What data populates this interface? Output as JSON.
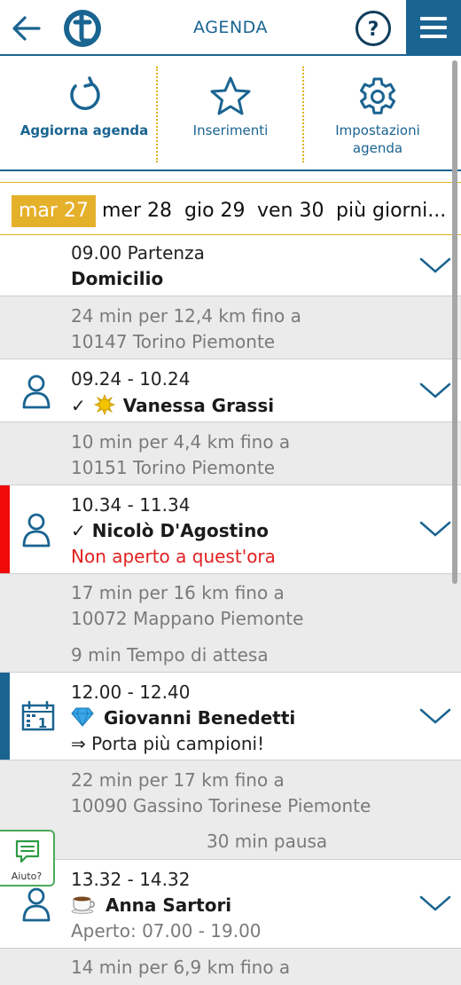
{
  "header": {
    "title": "AGENDA",
    "colors": {
      "brand": "#1a6491",
      "accent": "#e5b02a",
      "alert": "#e12121"
    }
  },
  "toolbar": {
    "refresh_label": "Aggiorna agenda",
    "insert_label": "Inserimenti",
    "settings_line1": "Impostazioni",
    "settings_line2": "agenda"
  },
  "dates": {
    "selected": "mar 27",
    "items": [
      "mer 28",
      "gio 29",
      "ven 30",
      "più giorni..."
    ]
  },
  "agenda": {
    "start": {
      "time": "09.00 Partenza",
      "place": "Domicilio"
    },
    "travel1": {
      "line1": "24 min per 12,4 km fino a",
      "line2": "10147 Torino Piemonte"
    },
    "appt1": {
      "time": "09.24 - 10.24",
      "check": "✓",
      "name": "Vanessa Grassi"
    },
    "travel2": {
      "line1": "10 min per 4,4 km fino a",
      "line2": "10151 Torino Piemonte"
    },
    "appt2": {
      "time": "10.34 - 11.34",
      "check": "✓",
      "name": "Nicolò D'Agostino",
      "note": "Non aperto a quest'ora"
    },
    "travel3": {
      "line1": "17 min per 16 km fino a",
      "line2": "10072 Mappano Piemonte",
      "wait": "9 min Tempo di attesa"
    },
    "appt3": {
      "time": "12.00 - 12.40",
      "name": "Giovanni Benedetti",
      "note": "⇒ Porta più campioni!"
    },
    "travel4": {
      "line1": "22 min per 17 km fino a",
      "line2": "10090 Gassino Torinese Piemonte",
      "pause": "30 min pausa"
    },
    "appt4": {
      "time": "13.32 - 14.32",
      "name": "Anna Sartori",
      "hours": "Aperto: 07.00 - 19.00"
    },
    "travel5": {
      "line1": "14 min per 6,9 km fino a"
    }
  },
  "help_widget": {
    "label": "Aiuto?"
  }
}
